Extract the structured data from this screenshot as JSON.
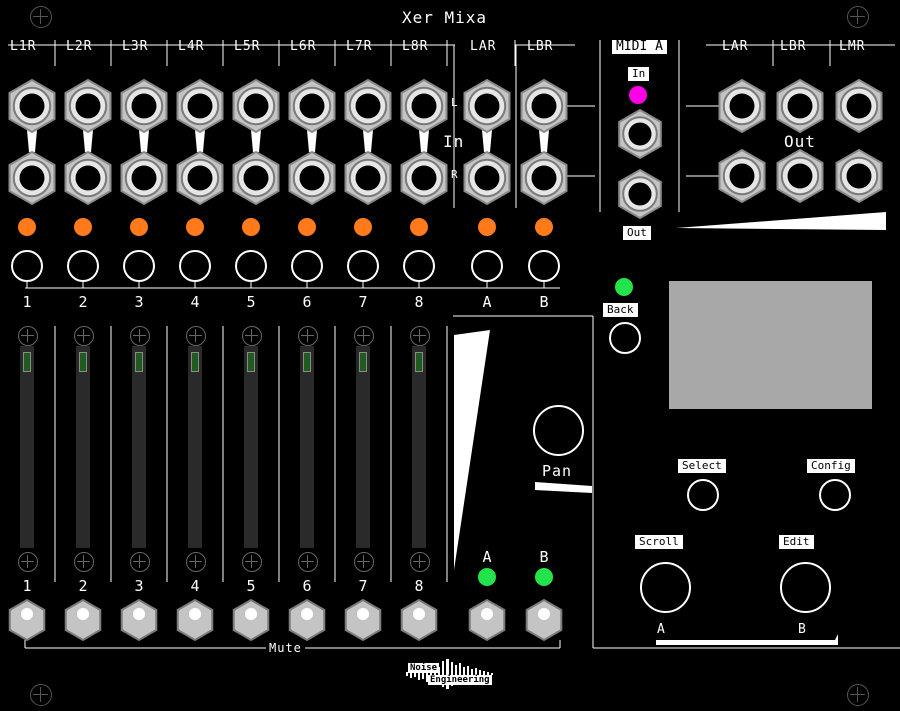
{
  "module": {
    "title": "Xer Mixa",
    "brand_line1": "Noise",
    "brand_line2": "Engineering"
  },
  "input_headers": [
    "L1R",
    "L2R",
    "L3R",
    "L4R",
    "L5R",
    "L6R",
    "L7R",
    "L8R",
    "LAR",
    "LBR"
  ],
  "output_headers": [
    "LAR",
    "LBR",
    "LMR"
  ],
  "jack_rows": {
    "upper": "L",
    "lower": "R"
  },
  "in_label": "In",
  "out_label": "Out",
  "midi": {
    "title": "MIDI A",
    "in": "In",
    "out": "Out"
  },
  "channels": [
    "1",
    "2",
    "3",
    "4",
    "5",
    "6",
    "7",
    "8",
    "A",
    "B"
  ],
  "fader_channels": [
    "1",
    "2",
    "3",
    "4",
    "5",
    "6",
    "7",
    "8"
  ],
  "mute_channels": [
    "A",
    "B"
  ],
  "mute_label": "Mute",
  "pan_label": "Pan",
  "controls": {
    "back": "Back",
    "select": "Select",
    "config": "Config",
    "scroll": "Scroll",
    "edit": "Edit"
  },
  "crossfade": {
    "left": "A",
    "right": "B"
  },
  "colors": {
    "panel": "#000000",
    "orange_led": "#ff7a1a",
    "green_led": "#22e44a",
    "magenta_led": "#ff00e6",
    "screen": "#a8a8a8",
    "jack_metal": "#c4c4c4"
  }
}
